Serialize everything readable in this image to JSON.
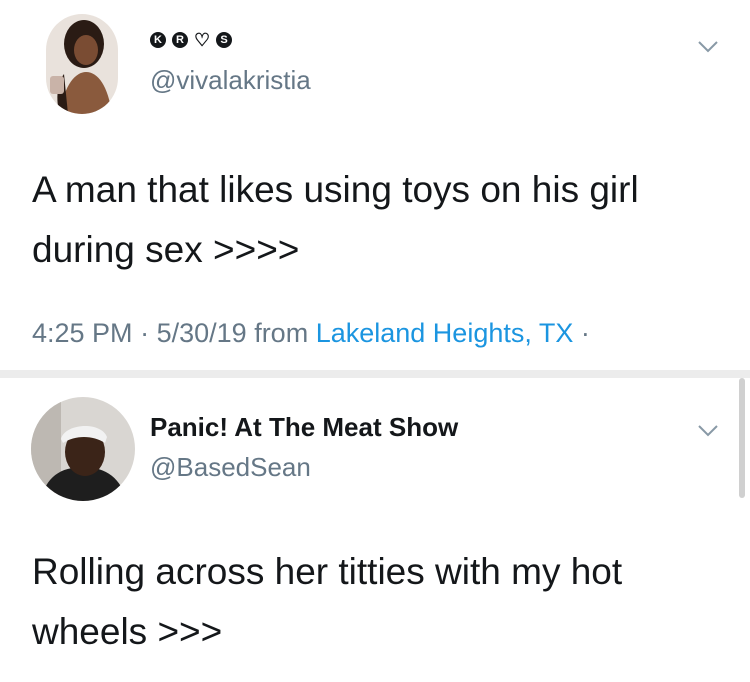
{
  "tweets": [
    {
      "badges": [
        "K",
        "R",
        "♡",
        "S"
      ],
      "handle": "@vivalakristia",
      "text": "A man that likes using toys on his girl during sex >>>>",
      "time": "4:25 PM",
      "date": "5/30/19",
      "from_label": "from",
      "location": "Lakeland Heights, TX",
      "trailing": "·"
    },
    {
      "name": "Panic! At The Meat Show",
      "handle": "@BasedSean",
      "text": "Rolling across her titties with my hot wheels >>>"
    }
  ],
  "icons": {
    "menu": "chevron-down-icon"
  },
  "colors": {
    "text": "#14171a",
    "muted": "#657786",
    "link": "#1b95e0"
  }
}
